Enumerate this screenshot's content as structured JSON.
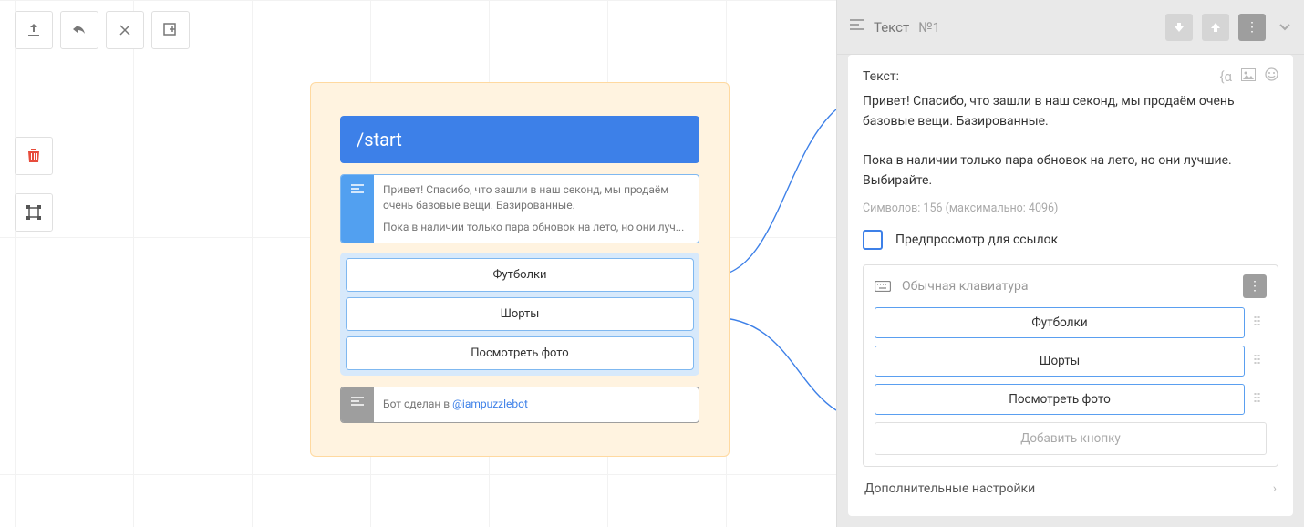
{
  "canvas": {
    "node": {
      "header": "/start",
      "text_lines": [
        "Привет! Спасибо, что зашли в наш секонд, мы продаём очень базовые вещи. Базированные.",
        "Пока в наличии только пара обновок на лето, но они луч..."
      ],
      "keyboard": [
        "Футболки",
        "Шорты",
        "Посмотреть фото"
      ],
      "footer_prefix": "Бот сделан в ",
      "footer_link": "@iampuzzlebot"
    }
  },
  "panel": {
    "head": {
      "title": "Текст",
      "number": "№1"
    },
    "text_label": "Текст:",
    "text_body": "Привет! Спасибо, что зашли в наш секонд, мы продаём очень базовые вещи. Базированные.\n\nПока в наличии только пара обновок на лето, но они лучшие. Выбирайте.",
    "chars": "Символов: 156 (максимально: 4096)",
    "preview_label": "Предпросмотр для ссылок",
    "keyboard": {
      "title": "Обычная клавиатура",
      "buttons": [
        "Футболки",
        "Шорты",
        "Посмотреть фото"
      ],
      "add_label": "Добавить кнопку"
    },
    "advanced": "Дополнительные настройки"
  }
}
